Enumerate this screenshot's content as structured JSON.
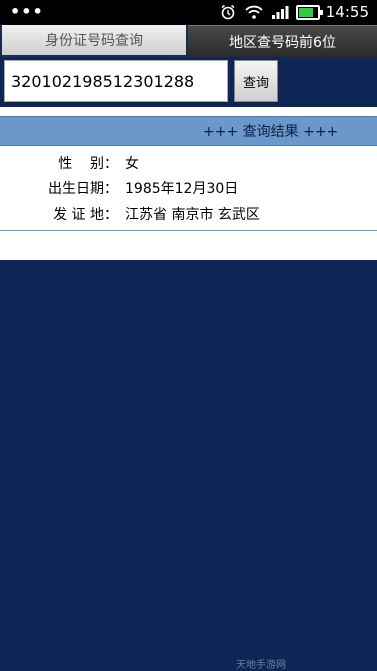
{
  "status_bar": {
    "time": "14:55",
    "icons": [
      "more-dots-icon",
      "alarm-icon",
      "wifi-icon",
      "signal-icon",
      "battery-icon"
    ]
  },
  "tabs": [
    {
      "label": "身份证号码查询",
      "active": true
    },
    {
      "label": "地区查号码前6位",
      "active": false
    }
  ],
  "search": {
    "id_value": "320102198512301288",
    "button_label": "查询"
  },
  "result": {
    "header": "+++ 查询结果 +++",
    "rows": [
      {
        "label": "性    别：",
        "value": "女"
      },
      {
        "label": "出生日期：",
        "value": "1985年12月30日"
      },
      {
        "label": "发 证 地：",
        "value": "江苏省 南京市 玄武区"
      }
    ]
  },
  "watermark": "天地手游网",
  "colors": {
    "background": "#0e2655",
    "result_header": "#6b98c8",
    "battery": "#2ecc40"
  }
}
